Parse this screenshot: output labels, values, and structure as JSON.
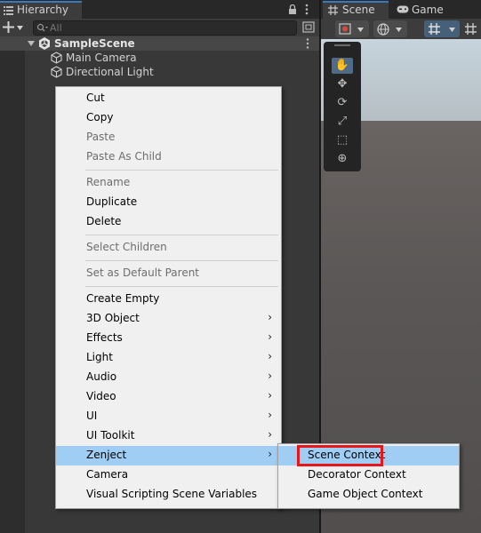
{
  "hierarchy": {
    "tab_label": "Hierarchy",
    "search_placeholder": "All",
    "scene_name": "SampleScene",
    "objects": [
      "Main Camera",
      "Directional Light"
    ]
  },
  "scene_view": {
    "tabs": [
      "Scene",
      "Game"
    ]
  },
  "context_menu": {
    "items": [
      {
        "label": "Cut",
        "enabled": true
      },
      {
        "label": "Copy",
        "enabled": true
      },
      {
        "label": "Paste",
        "enabled": false
      },
      {
        "label": "Paste As Child",
        "enabled": false
      },
      {
        "label": "Rename",
        "enabled": false
      },
      {
        "label": "Duplicate",
        "enabled": true
      },
      {
        "label": "Delete",
        "enabled": true
      },
      {
        "label": "Select Children",
        "enabled": false
      },
      {
        "label": "Set as Default Parent",
        "enabled": false
      },
      {
        "label": "Create Empty",
        "enabled": true
      },
      {
        "label": "3D Object",
        "enabled": true,
        "submenu": true
      },
      {
        "label": "Effects",
        "enabled": true,
        "submenu": true
      },
      {
        "label": "Light",
        "enabled": true,
        "submenu": true
      },
      {
        "label": "Audio",
        "enabled": true,
        "submenu": true
      },
      {
        "label": "Video",
        "enabled": true,
        "submenu": true
      },
      {
        "label": "UI",
        "enabled": true,
        "submenu": true
      },
      {
        "label": "UI Toolkit",
        "enabled": true,
        "submenu": true
      },
      {
        "label": "Zenject",
        "enabled": true,
        "submenu": true,
        "selected": true
      },
      {
        "label": "Camera",
        "enabled": true
      },
      {
        "label": "Visual Scripting Scene Variables",
        "enabled": true
      }
    ],
    "submenu_glyph": "›"
  },
  "zenject_submenu": {
    "items": [
      "Scene Context",
      "Decorator Context",
      "Game Object Context"
    ],
    "selected": "Scene Context"
  },
  "colors": {
    "selection": "#9fcdf3",
    "highlight_box": "#e8161b",
    "tab_accent": "#3a79bb"
  }
}
